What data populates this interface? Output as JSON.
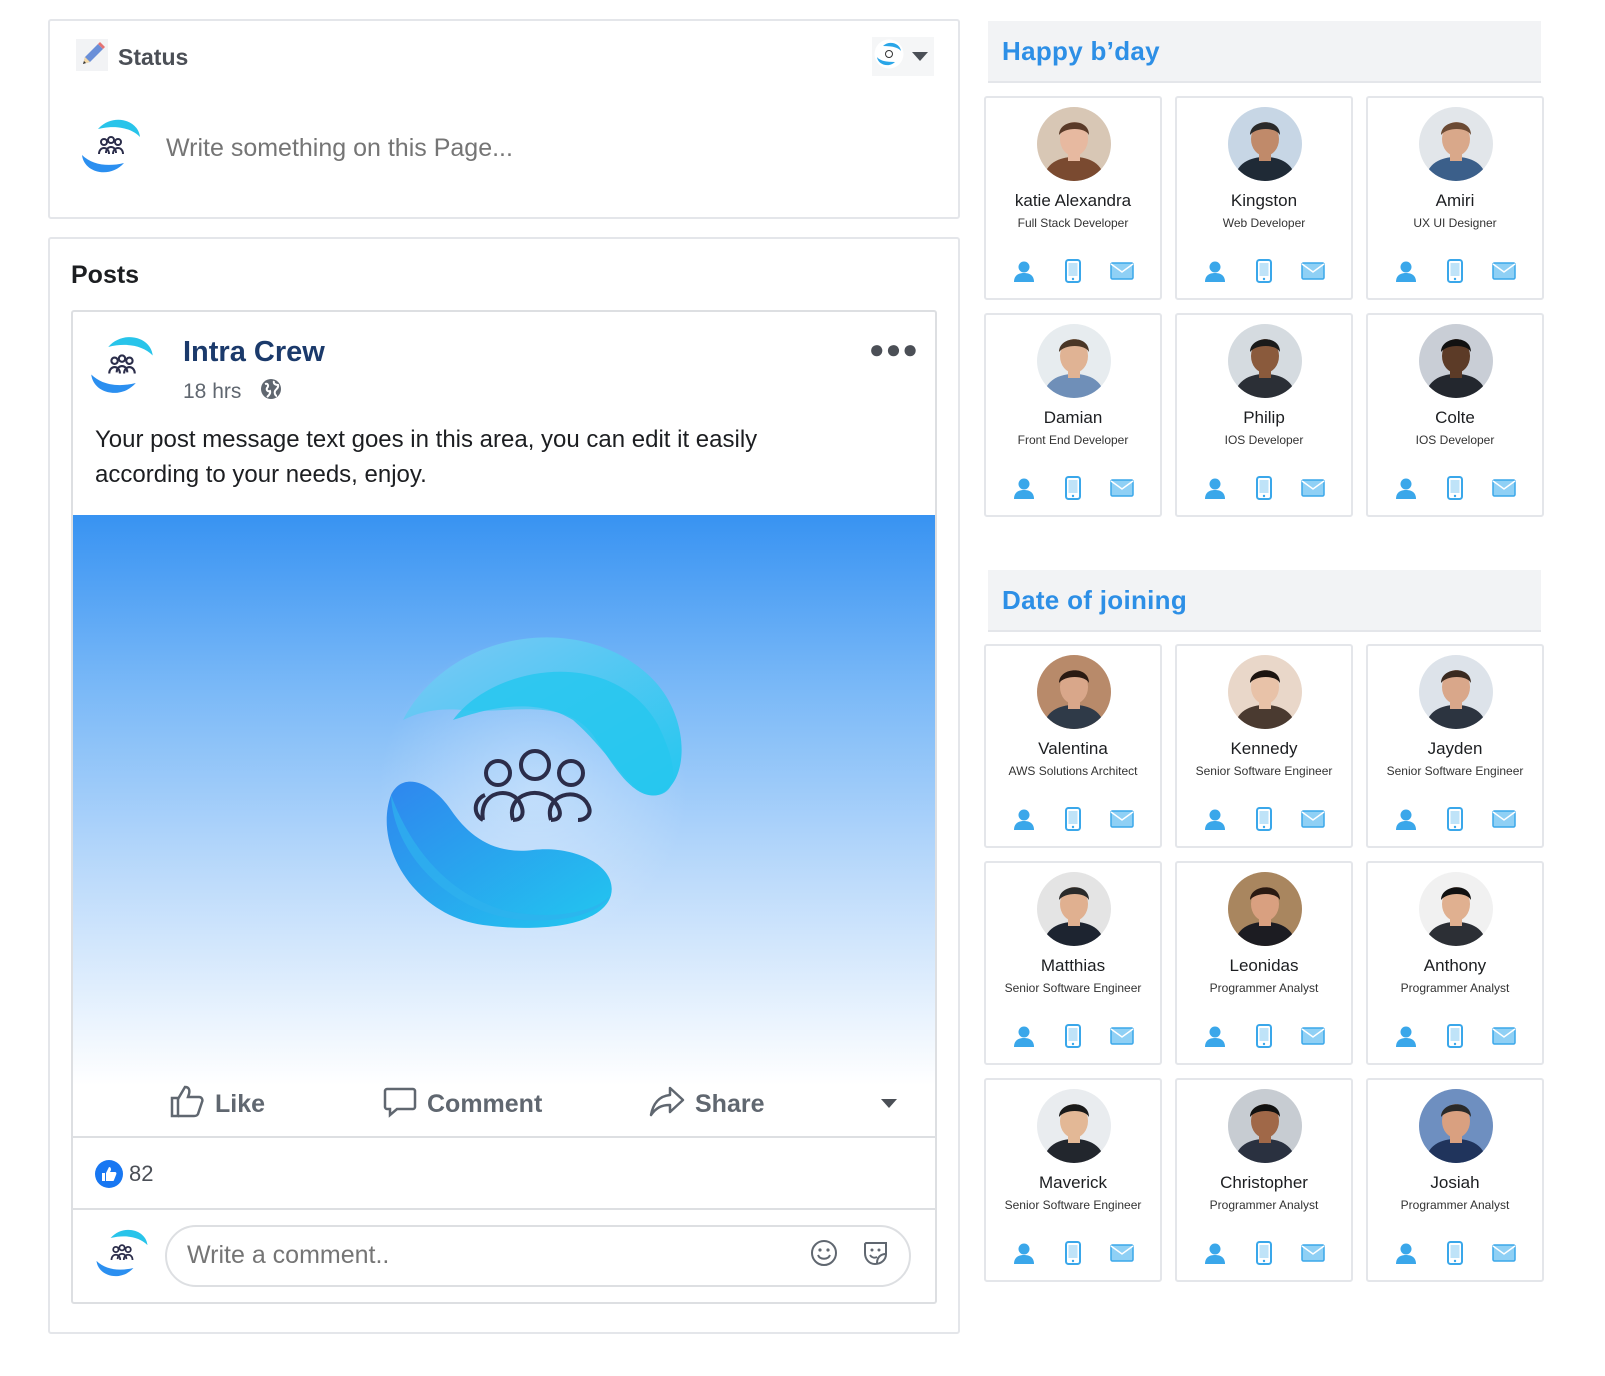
{
  "status": {
    "title": "Status",
    "placeholder": "Write something on this Page..."
  },
  "posts": {
    "title": "Posts",
    "post": {
      "author": "Intra Crew",
      "time": "18 hrs",
      "text": "Your post message text goes in this area, you can edit it easily according to your needs, enjoy.",
      "actions": {
        "like": "Like",
        "comment": "Comment",
        "share": "Share"
      },
      "like_count": "82",
      "comment_placeholder": "Write a comment.."
    }
  },
  "birthday": {
    "title": "Happy b’day",
    "people": [
      {
        "name": "katie Alexandra",
        "role": "Full Stack Developer"
      },
      {
        "name": "Kingston",
        "role": "Web Developer"
      },
      {
        "name": "Amiri",
        "role": "UX UI Designer"
      },
      {
        "name": "Damian",
        "role": "Front End Developer"
      },
      {
        "name": "Philip",
        "role": "IOS Developer"
      },
      {
        "name": "Colte",
        "role": "IOS Developer"
      }
    ]
  },
  "joining": {
    "title": "Date of joining",
    "people": [
      {
        "name": "Valentina",
        "role": "AWS Solutions Architect"
      },
      {
        "name": "Kennedy",
        "role": "Senior Software Engineer"
      },
      {
        "name": "Jayden",
        "role": "Senior Software Engineer"
      },
      {
        "name": "Matthias",
        "role": "Senior Software Engineer"
      },
      {
        "name": "Leonidas",
        "role": "Programmer Analyst"
      },
      {
        "name": "Anthony",
        "role": "Programmer Analyst"
      },
      {
        "name": "Maverick",
        "role": "Senior Software Engineer"
      },
      {
        "name": "Christopher",
        "role": "Programmer Analyst"
      },
      {
        "name": "Josiah",
        "role": "Programmer Analyst"
      }
    ]
  },
  "colors": {
    "accent": "#2d8fe6",
    "brand_dark": "#1b3a6b",
    "like_blue": "#1877f2"
  },
  "icons": [
    "pencil-icon",
    "logo-icon",
    "more-icon",
    "globe-icon",
    "like-icon",
    "comment-icon",
    "share-icon",
    "smiley-icon",
    "sticker-icon",
    "profile-icon",
    "phone-icon",
    "mail-icon"
  ]
}
